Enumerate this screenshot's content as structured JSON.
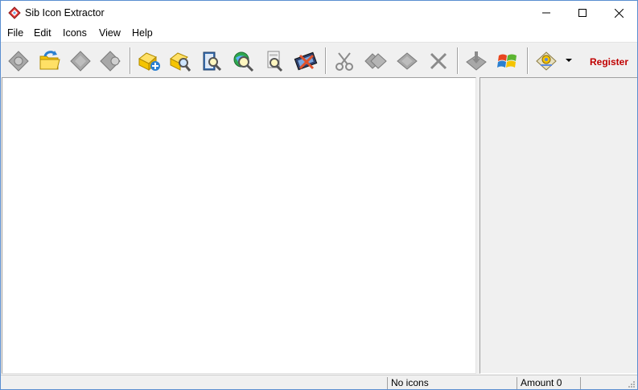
{
  "window": {
    "title": "Sib Icon Extractor"
  },
  "menu": {
    "items": [
      "File",
      "Edit",
      "Icons",
      "View",
      "Help"
    ]
  },
  "toolbar": {
    "buttons": [
      {
        "icon": "gear-gray-icon",
        "enabled": false
      },
      {
        "icon": "open-folder-icon",
        "enabled": true
      },
      {
        "icon": "gray-diamond-icon",
        "enabled": false
      },
      {
        "icon": "gray-search-diamond-icon",
        "enabled": false
      },
      {
        "icon": "add-folder-icon",
        "enabled": true
      },
      {
        "icon": "search-folder-icon",
        "enabled": true
      },
      {
        "icon": "search-book-icon",
        "enabled": true
      },
      {
        "icon": "search-web-icon",
        "enabled": true
      },
      {
        "icon": "search-file-icon",
        "enabled": true
      },
      {
        "icon": "film-extract-icon",
        "enabled": true
      },
      {
        "icon": "cut-icon",
        "enabled": false
      },
      {
        "icon": "copy-icon",
        "enabled": false
      },
      {
        "icon": "paste-icon",
        "enabled": false
      },
      {
        "icon": "delete-icon",
        "enabled": false
      },
      {
        "icon": "save-icon",
        "enabled": false
      },
      {
        "icon": "windows-logo-icon",
        "enabled": true
      },
      {
        "icon": "settings-icon",
        "enabled": true
      }
    ],
    "register_label": "Register"
  },
  "status": {
    "icons_text": "No icons",
    "amount_text": "Amount 0"
  },
  "colors": {
    "register": "#c00000",
    "border_accent": "#5a8ed0"
  }
}
